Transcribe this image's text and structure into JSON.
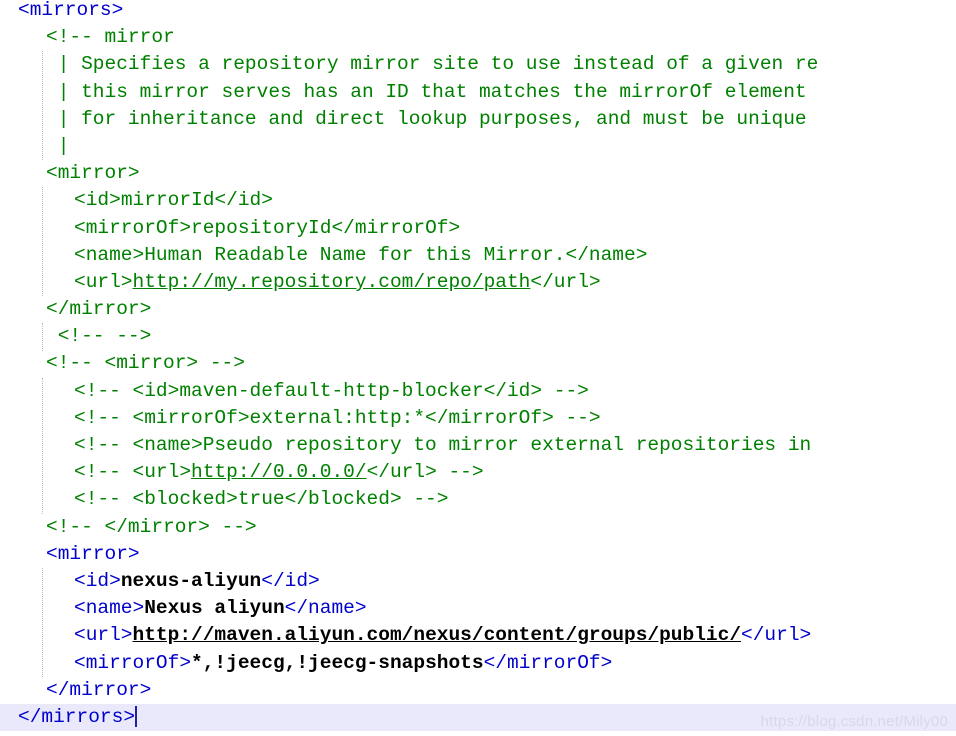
{
  "editor": {
    "language": "xml",
    "file_kind": "maven-settings",
    "font_size_px": 19.5,
    "line_height_px": 27.2,
    "colors": {
      "background": "#ffffff",
      "tag": "#0000cc",
      "comment": "#008000",
      "value": "#000000",
      "current_line_highlight": "#e9e9fb",
      "caret": "#2020a0",
      "indent_guide": "#b9b9b9",
      "watermark": "#d8d8e8"
    },
    "current_line_index": 25,
    "caret": {
      "line": 25,
      "column": 11
    }
  },
  "watermark": {
    "text": "https://blog.csdn.net/Mily00"
  },
  "lines": [
    {
      "index": 0,
      "indent": 0,
      "current": false,
      "tokens": [
        {
          "kind": "tag",
          "text": "<mirrors>"
        }
      ]
    },
    {
      "index": 1,
      "indent": 1,
      "current": false,
      "tokens": [
        {
          "kind": "comment",
          "text": "<!-- mirror"
        }
      ]
    },
    {
      "index": 2,
      "indent": 1,
      "current": false,
      "tokens": [
        {
          "kind": "comment",
          "text": " | Specifies a repository mirror site to use instead of a given re"
        }
      ]
    },
    {
      "index": 3,
      "indent": 1,
      "current": false,
      "tokens": [
        {
          "kind": "comment",
          "text": " | this mirror serves has an ID that matches the mirrorOf element "
        }
      ]
    },
    {
      "index": 4,
      "indent": 1,
      "current": false,
      "tokens": [
        {
          "kind": "comment",
          "text": " | for inheritance and direct lookup purposes, and must be unique "
        }
      ]
    },
    {
      "index": 5,
      "indent": 1,
      "current": false,
      "tokens": [
        {
          "kind": "comment",
          "text": " |"
        }
      ]
    },
    {
      "index": 6,
      "indent": 1,
      "current": false,
      "tokens": [
        {
          "kind": "tag-green",
          "text": "<mirror>"
        }
      ]
    },
    {
      "index": 7,
      "indent": 2,
      "current": false,
      "tokens": [
        {
          "kind": "tag-green",
          "text": "<id>"
        },
        {
          "kind": "comment",
          "text": "mirrorId"
        },
        {
          "kind": "tag-green",
          "text": "</id>"
        }
      ]
    },
    {
      "index": 8,
      "indent": 2,
      "current": false,
      "tokens": [
        {
          "kind": "tag-green",
          "text": "<mirrorOf>"
        },
        {
          "kind": "comment",
          "text": "repositoryId"
        },
        {
          "kind": "tag-green",
          "text": "</mirrorOf>"
        }
      ]
    },
    {
      "index": 9,
      "indent": 2,
      "current": false,
      "tokens": [
        {
          "kind": "tag-green",
          "text": "<name>"
        },
        {
          "kind": "comment",
          "text": "Human Readable Name for this Mirror."
        },
        {
          "kind": "tag-green",
          "text": "</name>"
        }
      ]
    },
    {
      "index": 10,
      "indent": 2,
      "current": false,
      "tokens": [
        {
          "kind": "tag-green",
          "text": "<url>"
        },
        {
          "kind": "url-green",
          "text": "http://my.repository.com/repo/path"
        },
        {
          "kind": "tag-green",
          "text": "</url>"
        }
      ]
    },
    {
      "index": 11,
      "indent": 1,
      "current": false,
      "tokens": [
        {
          "kind": "tag-green",
          "text": "</mirror>"
        }
      ]
    },
    {
      "index": 12,
      "indent": 1,
      "current": false,
      "tokens": [
        {
          "kind": "comment",
          "text": " <!-- -->"
        }
      ]
    },
    {
      "index": 13,
      "indent": 1,
      "current": false,
      "tokens": [
        {
          "kind": "comment",
          "text": "<!-- <mirror> -->"
        }
      ]
    },
    {
      "index": 14,
      "indent": 2,
      "current": false,
      "tokens": [
        {
          "kind": "comment",
          "text": "<!-- <id>maven-default-http-blocker</id> -->"
        }
      ]
    },
    {
      "index": 15,
      "indent": 2,
      "current": false,
      "tokens": [
        {
          "kind": "comment",
          "text": "<!-- <mirrorOf>external:http:*</mirrorOf> -->"
        }
      ]
    },
    {
      "index": 16,
      "indent": 2,
      "current": false,
      "tokens": [
        {
          "kind": "comment",
          "text": "<!-- <name>Pseudo repository to mirror external repositories in"
        }
      ]
    },
    {
      "index": 17,
      "indent": 2,
      "current": false,
      "tokens": [
        {
          "kind": "comment",
          "text": "<!-- <url>"
        },
        {
          "kind": "url-green",
          "text": "http://0.0.0.0/"
        },
        {
          "kind": "comment",
          "text": "</url> -->"
        }
      ]
    },
    {
      "index": 18,
      "indent": 2,
      "current": false,
      "tokens": [
        {
          "kind": "comment",
          "text": "<!-- <blocked>true</blocked> -->"
        }
      ]
    },
    {
      "index": 19,
      "indent": 1,
      "current": false,
      "tokens": [
        {
          "kind": "comment",
          "text": "<!-- </mirror> -->"
        }
      ]
    },
    {
      "index": 20,
      "indent": 1,
      "current": false,
      "tokens": [
        {
          "kind": "tag",
          "text": "<mirror>"
        }
      ]
    },
    {
      "index": 21,
      "indent": 2,
      "current": false,
      "tokens": [
        {
          "kind": "tag",
          "text": "<id>"
        },
        {
          "kind": "value",
          "text": "nexus-aliyun"
        },
        {
          "kind": "tag",
          "text": "</id>"
        }
      ]
    },
    {
      "index": 22,
      "indent": 2,
      "current": false,
      "tokens": [
        {
          "kind": "tag",
          "text": "<name>"
        },
        {
          "kind": "value",
          "text": "Nexus aliyun"
        },
        {
          "kind": "tag",
          "text": "</name>"
        }
      ]
    },
    {
      "index": 23,
      "indent": 2,
      "current": false,
      "tokens": [
        {
          "kind": "tag",
          "text": "<url>"
        },
        {
          "kind": "url-value",
          "text": "http://maven.aliyun.com/nexus/content/groups/public/"
        },
        {
          "kind": "tag",
          "text": "</url>"
        }
      ]
    },
    {
      "index": 24,
      "indent": 2,
      "current": false,
      "tokens": [
        {
          "kind": "tag",
          "text": "<mirrorOf>"
        },
        {
          "kind": "value",
          "text": "*,!jeecg,!jeecg-snapshots"
        },
        {
          "kind": "tag",
          "text": "</mirrorOf>"
        }
      ]
    },
    {
      "index": 25,
      "indent": 1,
      "current": false,
      "tokens": [
        {
          "kind": "tag",
          "text": "</mirror>"
        }
      ]
    },
    {
      "index": 26,
      "indent": 0,
      "current": true,
      "tokens": [
        {
          "kind": "tag",
          "text": "</mirrors>"
        }
      ]
    }
  ],
  "indent_guides": [
    {
      "x": 42,
      "top_line": 2,
      "bottom_line": 5
    },
    {
      "x": 42,
      "top_line": 7,
      "bottom_line": 10
    },
    {
      "x": 42,
      "top_line": 12,
      "bottom_line": 12
    },
    {
      "x": 42,
      "top_line": 14,
      "bottom_line": 18
    },
    {
      "x": 42,
      "top_line": 21,
      "bottom_line": 24
    }
  ]
}
